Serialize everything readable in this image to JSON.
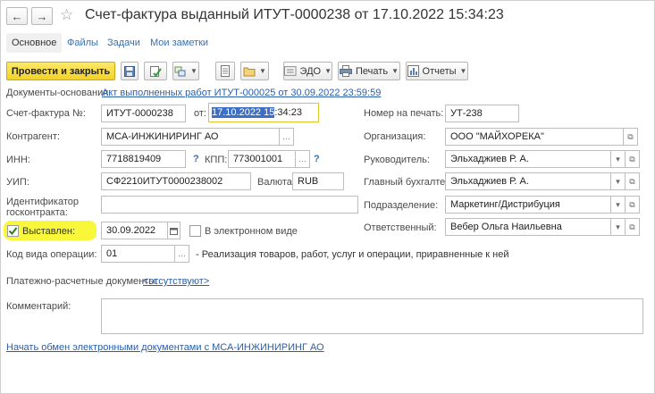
{
  "header": {
    "title": "Счет-фактура выданный ИТУТ-0000238 от 17.10.2022 15:34:23",
    "back_glyph": "←",
    "forward_glyph": "→",
    "star_glyph": "☆"
  },
  "tabs": {
    "main": "Основное",
    "files": "Файлы",
    "tasks": "Задачи",
    "notes": "Мои заметки"
  },
  "toolbar": {
    "post_close": "Провести и закрыть",
    "edo": "ЭДО",
    "print": "Печать",
    "reports": "Отчеты"
  },
  "basis": {
    "label": "Документы-основания:",
    "link": "Акт выполненных работ ИТУТ-000025 от 30.09.2022 23:59:59"
  },
  "invoice": {
    "label": "Счет-фактура №:",
    "number": "ИТУТ-0000238",
    "from_label": "от:",
    "date_selected": "17.10.2022 15",
    "time_rest": ":34:23"
  },
  "print_number": {
    "label": "Номер на печать:",
    "value": "УТ-238"
  },
  "counterparty": {
    "label": "Контрагент:",
    "value": "МСА-ИНЖИНИРИНГ АО"
  },
  "organization": {
    "label": "Организация:",
    "value": "ООО \"МАЙХОРЕКА\""
  },
  "inn": {
    "label": "ИНН:",
    "value": "7718819409",
    "q": "?"
  },
  "kpp": {
    "label": "КПП:",
    "value": "773001001",
    "q": "?"
  },
  "head": {
    "label": "Руководитель:",
    "value": "Эльхаджиев Р. А."
  },
  "uip": {
    "label": "УИП:",
    "value": "СФ2210ИТУТ0000238002"
  },
  "currency": {
    "label": "Валюта:",
    "value": "RUB"
  },
  "accountant": {
    "label": "Главный бухгалтер:",
    "value": "Эльхаджиев Р. А."
  },
  "gov_contract": {
    "label_line1": "Идентификатор",
    "label_line2": "госконтракта:"
  },
  "department": {
    "label": "Подразделение:",
    "value": "Маркетинг/Дистрибуция"
  },
  "issued": {
    "label": "Выставлен:",
    "date": "30.09.2022",
    "checked": true
  },
  "electronic": {
    "label": "В электронном виде"
  },
  "responsible": {
    "label": "Ответственный:",
    "value": "Вебер Ольга Наильевна"
  },
  "operation_code": {
    "label": "Код вида операции:",
    "value": "01",
    "description": "- Реализация товаров, работ, услуг и операции, приравненные к ней"
  },
  "payment_docs": {
    "label": "Платежно-расчетные документы:",
    "link": "<отсутствуют>"
  },
  "comment": {
    "label": "Комментарий:",
    "value": ""
  },
  "bottom_link": "Начать обмен электронными документами с МСА-ИНЖИНИРИНГ АО"
}
